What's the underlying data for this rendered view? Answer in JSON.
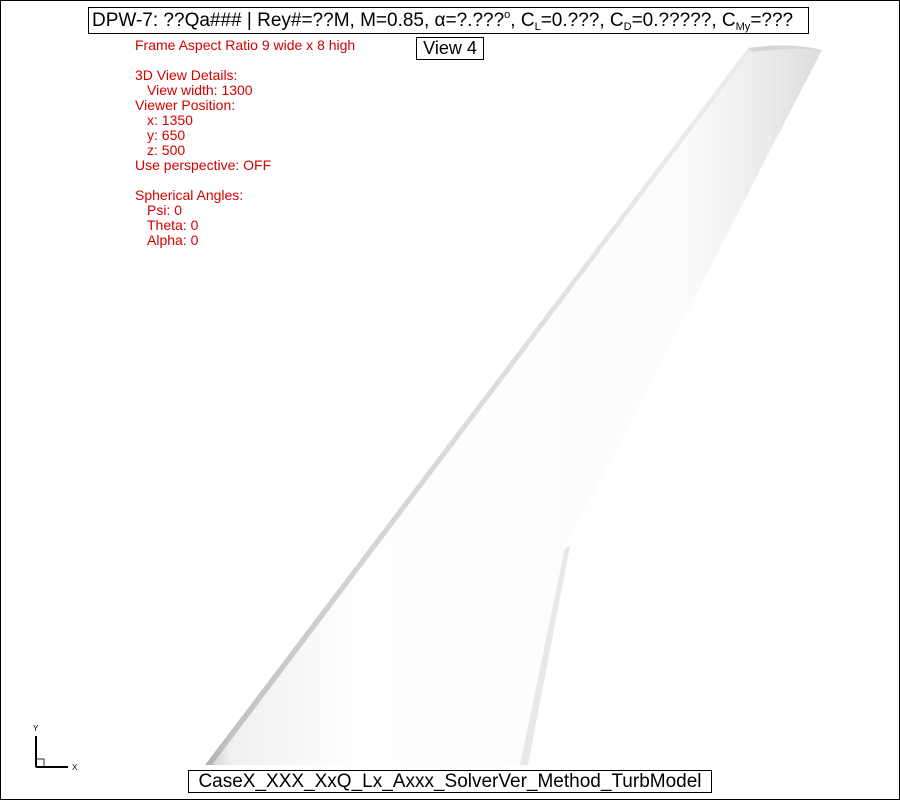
{
  "header": {
    "title_prefix": "DPW-7: ??Qa### | Rey#=??M, M=0.85, α=?.???",
    "title_deg": "o",
    "title_cl": ", C",
    "title_cl_sub": "L",
    "title_cl_val": "=0.???, C",
    "title_cd_sub": "D",
    "title_cd_val": "=0.?????, C",
    "title_cmy_sub": "My",
    "title_cmy_val": "=???"
  },
  "view_label": "View 4",
  "details": {
    "aspect": "Frame Aspect Ratio 9 wide x 8 high",
    "view_heading": "3D View Details:",
    "view_width": "View width: 1300",
    "viewer_position": "Viewer Position:",
    "x": "x: 1350",
    "y": "y: 650",
    "z": "z: 500",
    "perspective": "Use perspective: OFF",
    "spherical_heading": "Spherical Angles:",
    "psi": "Psi: 0",
    "theta": "Theta: 0",
    "alpha": "Alpha: 0"
  },
  "axis": {
    "x_label": "X",
    "y_label": "Y"
  },
  "case_label": "CaseX_XXX_XxQ_Lx_Axxx_SolverVer_Method_TurbModel",
  "colors": {
    "detail_text": "#d40000",
    "frame": "#000000",
    "wing_surface": "#f4f4f4"
  }
}
